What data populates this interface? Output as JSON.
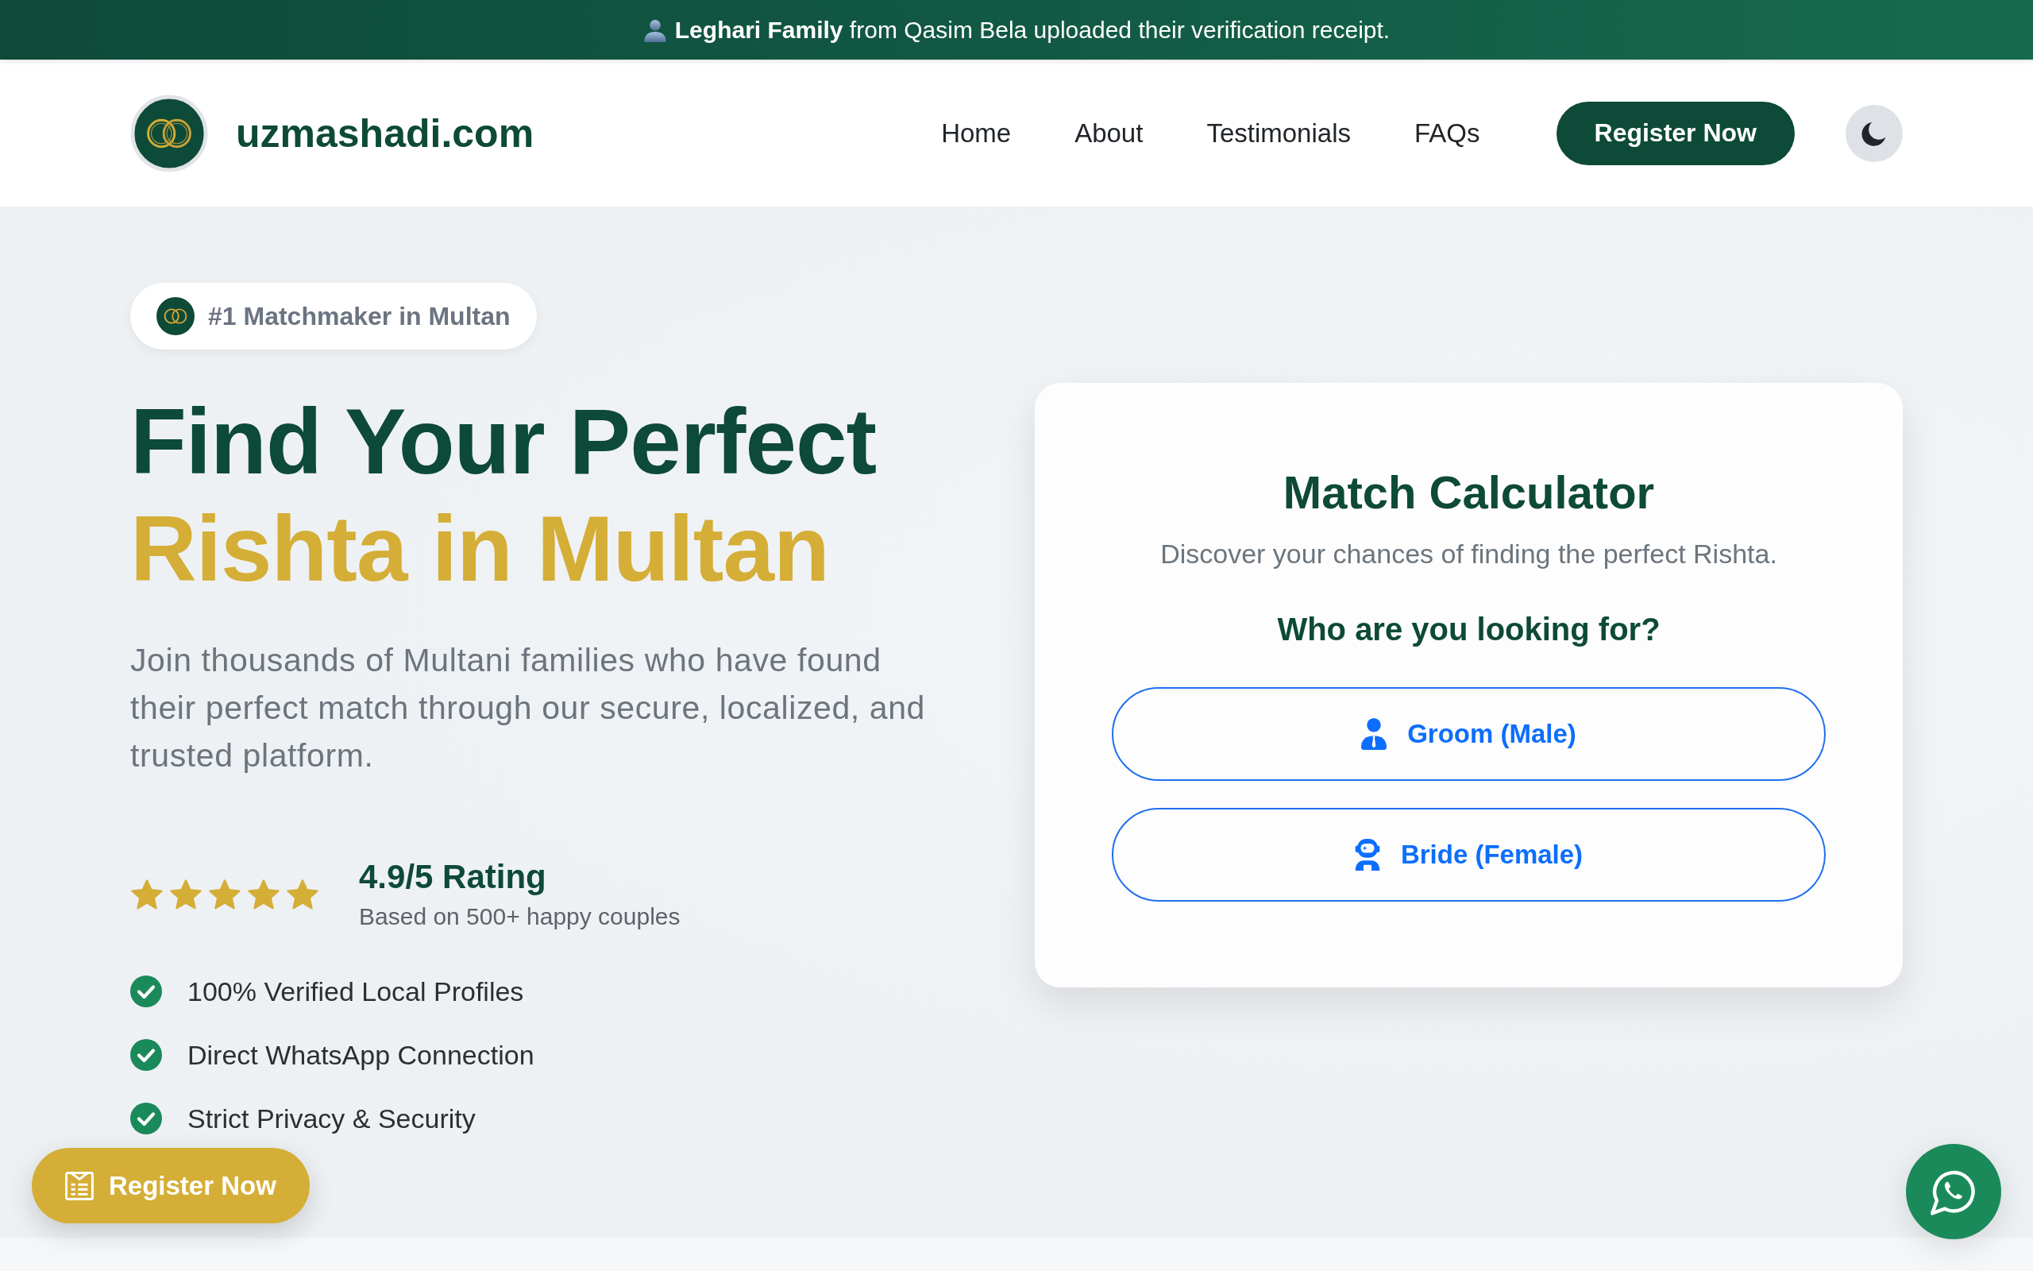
{
  "announcement": {
    "text": "**Leghari Family** from Qasim Bela uploaded their verification receipt."
  },
  "header": {
    "brand": "uzmashadi.com",
    "nav": [
      "Home",
      "About",
      "Testimonials",
      "FAQs"
    ],
    "cta": "Register Now"
  },
  "hero": {
    "badge": "#1 Matchmaker in Multan",
    "title_line_1": "Find Your Perfect",
    "title_line_2": "Rishta in Multan",
    "description": "Join thousands of Multani families who have found their perfect match through our secure, localized, and trusted platform.",
    "rating": {
      "stars": 5,
      "score": "4.9/5 Rating",
      "caption": "Based on 500+ happy couples"
    },
    "features": [
      "100% Verified Local Profiles",
      "Direct WhatsApp Connection",
      "Strict Privacy & Security"
    ]
  },
  "match_calculator": {
    "title": "Match Calculator",
    "subtitle": "Discover your chances of finding the perfect Rishta.",
    "question": "Who are you looking for?",
    "options": [
      {
        "label": "Groom (Male)",
        "kind": "groom",
        "selected": false
      },
      {
        "label": "Bride (Female)",
        "kind": "bride",
        "selected": false
      }
    ]
  },
  "floating_register": {
    "label": "Register Now"
  }
}
